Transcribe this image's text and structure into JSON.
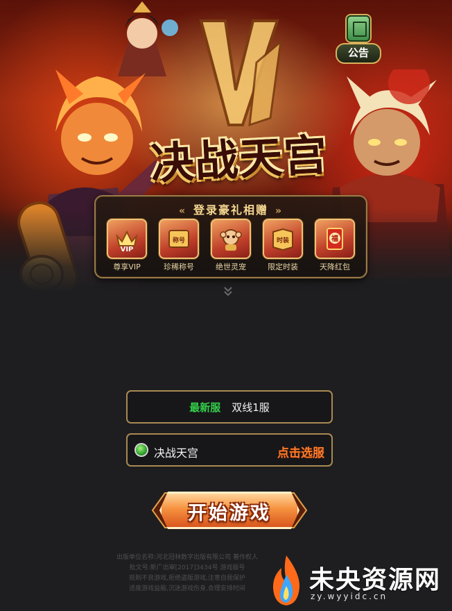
{
  "notice": {
    "label": "公告",
    "icon": "notice-board-icon"
  },
  "hero": {
    "title": "决战天宫"
  },
  "rewards": {
    "title": "登录豪礼相赠",
    "items": [
      {
        "name": "尊享VIP",
        "icon": "vip-crown-icon",
        "badge": "VIP"
      },
      {
        "name": "珍稀称号",
        "icon": "title-scroll-icon",
        "badge": "称号"
      },
      {
        "name": "绝世灵宠",
        "icon": "pet-monkey-icon",
        "badge": ""
      },
      {
        "name": "限定时装",
        "icon": "costume-book-icon",
        "badge": "时装"
      },
      {
        "name": "天降红包",
        "icon": "red-envelope-icon",
        "badge": "福"
      }
    ]
  },
  "server": {
    "latest_tag": "最新服",
    "latest_name": "双线1服",
    "current_name": "决战天宫",
    "pick_label": "点击选服"
  },
  "start_button": {
    "label": "开始游戏"
  },
  "footer": {
    "lines": [
      "出版单位名称:河北冠林数字出版有限公司   著作权人",
      "批文号:新广出审[2017]3434号   游戏版号",
      "抵制不良游戏,拒绝盗版游戏,注意自我保护",
      "适度游戏益脑,沉迷游戏伤身,合理安排时间"
    ]
  },
  "watermark": {
    "title": "未央资源网",
    "url": "zy.wyyidc.cn"
  }
}
